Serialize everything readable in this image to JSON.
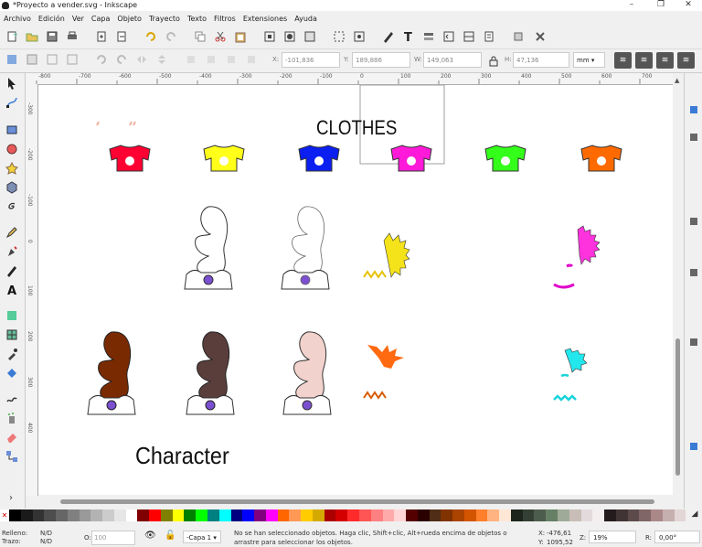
{
  "window": {
    "title": "*Proyecto a vender.svg - Inkscape",
    "minimize": "–",
    "maximize": "❐",
    "close": "✕"
  },
  "menu": [
    "Archivo",
    "Edición",
    "Ver",
    "Capa",
    "Objeto",
    "Trayecto",
    "Texto",
    "Filtros",
    "Extensiones",
    "Ayuda"
  ],
  "controls": {
    "x_label": "X:",
    "x_value": "-101,836",
    "y_label": "Y:",
    "y_value": "189,886",
    "w_label": "W:",
    "w_value": "149,063",
    "h_label": "H:",
    "h_value": "47,136",
    "unit": "mm"
  },
  "ruler": {
    "h_ticks": [
      "-800",
      "-700",
      "-600",
      "-500",
      "-400",
      "-300",
      "-200",
      "-100",
      "0",
      "100",
      "200",
      "300",
      "400",
      "500",
      "600",
      "700"
    ],
    "v_ticks": [
      "-300",
      "-200",
      "-100",
      "0",
      "100",
      "200",
      "300",
      "400"
    ]
  },
  "canvas": {
    "clothes_title": "CLOTHES",
    "character_title": "Character"
  },
  "palette": {
    "colors": [
      "#000000",
      "#1a1a1a",
      "#333333",
      "#4d4d4d",
      "#666666",
      "#808080",
      "#999999",
      "#b3b3b3",
      "#cccccc",
      "#e6e6e6",
      "#ffffff",
      "#800000",
      "#ff0000",
      "#808000",
      "#ffff00",
      "#008000",
      "#00ff00",
      "#008080",
      "#00ffff",
      "#000080",
      "#0000ff",
      "#800080",
      "#ff00ff",
      "#ff6600",
      "#ff9955",
      "#ffcc00",
      "#d4aa00",
      "#aa0000",
      "#d40000",
      "#ff2a2a",
      "#ff5555",
      "#ff8080",
      "#ffaaaa",
      "#ffd5d5",
      "#550000",
      "#2b0000",
      "#502d16",
      "#803300",
      "#aa4400",
      "#d45500",
      "#ff7f2a",
      "#ffb380",
      "#ffe6d5",
      "#1c241c",
      "#334033",
      "#4d5d4d",
      "#668066",
      "#a0aa99",
      "#c8beb7",
      "#e3dbdb",
      "#f4eeee",
      "#241c1c",
      "#403434",
      "#5d4b4b",
      "#806666",
      "#aa8888",
      "#c6afaf",
      "#e3d6d6"
    ]
  },
  "status": {
    "fill_label": "Relleno:",
    "fill_value": "N/D",
    "stroke_label": "Trazo:",
    "stroke_value": "N/D",
    "opacity_label": "O:",
    "opacity_value": "100",
    "layer": "-Capa 1",
    "message": "No se han seleccionado objetos. Haga clic, Shift+clic, Alt+rueda encima de objetos o arrastre para seleccionar los objetos.",
    "cx_label": "X:",
    "cx_value": "-476,61",
    "cy_label": "Y:",
    "cy_value": "1095,52",
    "zoom_label": "Z:",
    "zoom_value": "19%",
    "rot_label": "R:",
    "rot_value": "0,00°"
  }
}
